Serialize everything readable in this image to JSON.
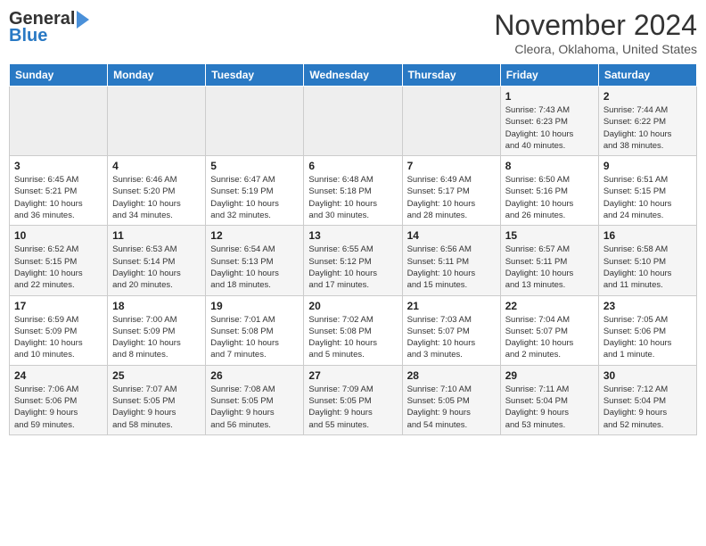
{
  "header": {
    "logo_line1": "General",
    "logo_line2": "Blue",
    "month": "November 2024",
    "location": "Cleora, Oklahoma, United States"
  },
  "weekdays": [
    "Sunday",
    "Monday",
    "Tuesday",
    "Wednesday",
    "Thursday",
    "Friday",
    "Saturday"
  ],
  "weeks": [
    [
      {
        "day": "",
        "info": ""
      },
      {
        "day": "",
        "info": ""
      },
      {
        "day": "",
        "info": ""
      },
      {
        "day": "",
        "info": ""
      },
      {
        "day": "",
        "info": ""
      },
      {
        "day": "1",
        "info": "Sunrise: 7:43 AM\nSunset: 6:23 PM\nDaylight: 10 hours\nand 40 minutes."
      },
      {
        "day": "2",
        "info": "Sunrise: 7:44 AM\nSunset: 6:22 PM\nDaylight: 10 hours\nand 38 minutes."
      }
    ],
    [
      {
        "day": "3",
        "info": "Sunrise: 6:45 AM\nSunset: 5:21 PM\nDaylight: 10 hours\nand 36 minutes."
      },
      {
        "day": "4",
        "info": "Sunrise: 6:46 AM\nSunset: 5:20 PM\nDaylight: 10 hours\nand 34 minutes."
      },
      {
        "day": "5",
        "info": "Sunrise: 6:47 AM\nSunset: 5:19 PM\nDaylight: 10 hours\nand 32 minutes."
      },
      {
        "day": "6",
        "info": "Sunrise: 6:48 AM\nSunset: 5:18 PM\nDaylight: 10 hours\nand 30 minutes."
      },
      {
        "day": "7",
        "info": "Sunrise: 6:49 AM\nSunset: 5:17 PM\nDaylight: 10 hours\nand 28 minutes."
      },
      {
        "day": "8",
        "info": "Sunrise: 6:50 AM\nSunset: 5:16 PM\nDaylight: 10 hours\nand 26 minutes."
      },
      {
        "day": "9",
        "info": "Sunrise: 6:51 AM\nSunset: 5:15 PM\nDaylight: 10 hours\nand 24 minutes."
      }
    ],
    [
      {
        "day": "10",
        "info": "Sunrise: 6:52 AM\nSunset: 5:15 PM\nDaylight: 10 hours\nand 22 minutes."
      },
      {
        "day": "11",
        "info": "Sunrise: 6:53 AM\nSunset: 5:14 PM\nDaylight: 10 hours\nand 20 minutes."
      },
      {
        "day": "12",
        "info": "Sunrise: 6:54 AM\nSunset: 5:13 PM\nDaylight: 10 hours\nand 18 minutes."
      },
      {
        "day": "13",
        "info": "Sunrise: 6:55 AM\nSunset: 5:12 PM\nDaylight: 10 hours\nand 17 minutes."
      },
      {
        "day": "14",
        "info": "Sunrise: 6:56 AM\nSunset: 5:11 PM\nDaylight: 10 hours\nand 15 minutes."
      },
      {
        "day": "15",
        "info": "Sunrise: 6:57 AM\nSunset: 5:11 PM\nDaylight: 10 hours\nand 13 minutes."
      },
      {
        "day": "16",
        "info": "Sunrise: 6:58 AM\nSunset: 5:10 PM\nDaylight: 10 hours\nand 11 minutes."
      }
    ],
    [
      {
        "day": "17",
        "info": "Sunrise: 6:59 AM\nSunset: 5:09 PM\nDaylight: 10 hours\nand 10 minutes."
      },
      {
        "day": "18",
        "info": "Sunrise: 7:00 AM\nSunset: 5:09 PM\nDaylight: 10 hours\nand 8 minutes."
      },
      {
        "day": "19",
        "info": "Sunrise: 7:01 AM\nSunset: 5:08 PM\nDaylight: 10 hours\nand 7 minutes."
      },
      {
        "day": "20",
        "info": "Sunrise: 7:02 AM\nSunset: 5:08 PM\nDaylight: 10 hours\nand 5 minutes."
      },
      {
        "day": "21",
        "info": "Sunrise: 7:03 AM\nSunset: 5:07 PM\nDaylight: 10 hours\nand 3 minutes."
      },
      {
        "day": "22",
        "info": "Sunrise: 7:04 AM\nSunset: 5:07 PM\nDaylight: 10 hours\nand 2 minutes."
      },
      {
        "day": "23",
        "info": "Sunrise: 7:05 AM\nSunset: 5:06 PM\nDaylight: 10 hours\nand 1 minute."
      }
    ],
    [
      {
        "day": "24",
        "info": "Sunrise: 7:06 AM\nSunset: 5:06 PM\nDaylight: 9 hours\nand 59 minutes."
      },
      {
        "day": "25",
        "info": "Sunrise: 7:07 AM\nSunset: 5:05 PM\nDaylight: 9 hours\nand 58 minutes."
      },
      {
        "day": "26",
        "info": "Sunrise: 7:08 AM\nSunset: 5:05 PM\nDaylight: 9 hours\nand 56 minutes."
      },
      {
        "day": "27",
        "info": "Sunrise: 7:09 AM\nSunset: 5:05 PM\nDaylight: 9 hours\nand 55 minutes."
      },
      {
        "day": "28",
        "info": "Sunrise: 7:10 AM\nSunset: 5:05 PM\nDaylight: 9 hours\nand 54 minutes."
      },
      {
        "day": "29",
        "info": "Sunrise: 7:11 AM\nSunset: 5:04 PM\nDaylight: 9 hours\nand 53 minutes."
      },
      {
        "day": "30",
        "info": "Sunrise: 7:12 AM\nSunset: 5:04 PM\nDaylight: 9 hours\nand 52 minutes."
      }
    ]
  ]
}
